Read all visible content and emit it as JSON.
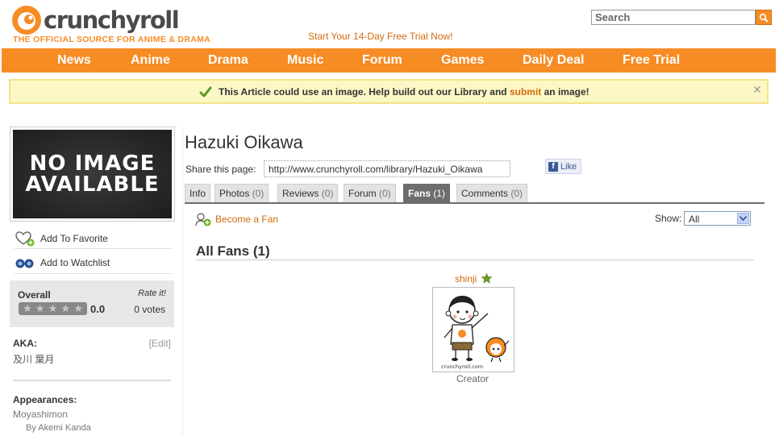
{
  "header": {
    "logo_text": "crunchyroll",
    "tagline": "THE OFFICIAL SOURCE FOR ANIME & DRAMA",
    "trial_text": "Start Your 14-Day Free Trial Now!",
    "search_placeholder": "Search",
    "brand_color": "#f78c25"
  },
  "nav": {
    "items": [
      "News",
      "Anime",
      "Drama",
      "Music",
      "Forum",
      "Games",
      "Daily Deal",
      "Free Trial"
    ]
  },
  "notice": {
    "text_before": "This Article could use an image. Help build out our Library and ",
    "link": "submit",
    "text_after": " an image!"
  },
  "sidebar": {
    "placeholder_line1": "NO IMAGE",
    "placeholder_line2": "AVAILABLE",
    "add_favorite": "Add To Favorite",
    "add_watchlist": "Add to Watchlist",
    "rating": {
      "overall_label": "Overall",
      "rate_it": "Rate it!",
      "score": "0.0",
      "votes": "0 votes",
      "stars_filled": 0,
      "stars_total": 5
    },
    "aka_label": "AKA:",
    "aka_edit": "[Edit]",
    "aka_value": "及川 葉月",
    "appearances_label": "Appearances:",
    "appearance_title": "Moyashimon",
    "appearance_by": "By Akemi Kanda"
  },
  "main": {
    "title": "Hazuki Oikawa",
    "share_label": "Share this page:",
    "share_url": "http://www.crunchyroll.com/library/Hazuki_Oikawa",
    "fb_like": "Like",
    "tabs": [
      {
        "label": "Info",
        "count": ""
      },
      {
        "label": "Photos",
        "count": "(0)"
      },
      {
        "label": "Reviews",
        "count": "(0)"
      },
      {
        "label": "Forum",
        "count": "(0)"
      },
      {
        "label": "Fans",
        "count": "(1)"
      },
      {
        "label": "Comments",
        "count": "(0)"
      }
    ],
    "active_tab": "Fans",
    "become_fan": "Become a Fan",
    "show_label": "Show:",
    "show_value": "All",
    "section_title": "All Fans (1)",
    "fans": [
      {
        "name": "shinji",
        "role": "Creator",
        "avatar_caption": "crunchyroll.com"
      }
    ]
  }
}
